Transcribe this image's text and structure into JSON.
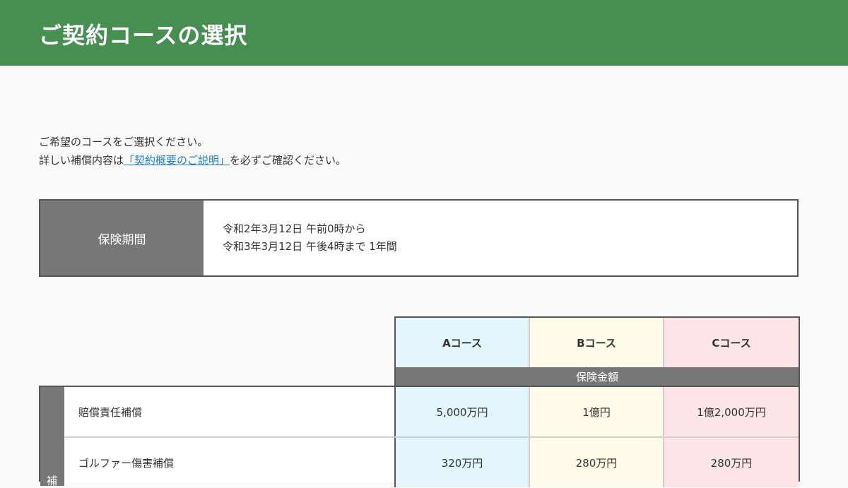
{
  "header": {
    "title": "ご契約コースの選択"
  },
  "intro": {
    "line1": "ご希望のコースをご選択ください。",
    "line2_prefix": "詳しい補償内容は",
    "link": "「契約概要のご説明」",
    "line2_suffix": "を必ずご確認ください。"
  },
  "period": {
    "label": "保険期間",
    "line1": "令和2年3月12日 午前0時から",
    "line2": "令和3年3月12日 午後4時まで 1年間"
  },
  "courses": [
    "Aコース",
    "Bコース",
    "Cコース"
  ],
  "amount_header": "保険金額",
  "side_label": "補",
  "rows": [
    {
      "name": "賠償責任補償",
      "values": [
        "5,000万円",
        "1億円",
        "1億2,000万円"
      ]
    },
    {
      "name": "ゴルファー傷害補償",
      "values": [
        "320万円",
        "280万円",
        "280万円"
      ]
    }
  ],
  "colors": {
    "header": "#468f51",
    "course_a": "#e3f5fc",
    "course_b": "#fff9e8",
    "course_c": "#fde5e7",
    "label_bg": "#777777",
    "link": "#1c7fc7"
  }
}
